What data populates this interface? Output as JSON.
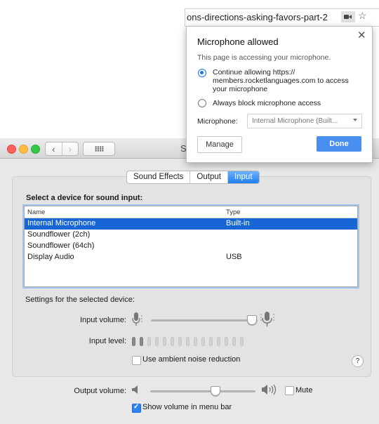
{
  "browser": {
    "url_text": "ons-directions-asking-favors-part-2",
    "camera_icon": "video-camera-icon",
    "bookmark_icon": "star-icon"
  },
  "popup": {
    "title": "Microphone allowed",
    "close_glyph": "✕",
    "subtitle": "This page is accessing your microphone.",
    "options": [
      {
        "line1": "Continue allowing https://",
        "line2": "members.rocketlanguages.com to access",
        "line3": "your microphone",
        "selected": true
      },
      {
        "line1": "Always block microphone access",
        "selected": false
      }
    ],
    "microphone_label": "Microphone:",
    "microphone_value": "Internal Microphone (Built...",
    "manage_label": "Manage",
    "done_label": "Done",
    "accent": "#4a8ef0"
  },
  "window": {
    "title": "S",
    "nav_back": "‹",
    "nav_forward": "›",
    "tabs": [
      {
        "label": "Sound Effects",
        "active": false
      },
      {
        "label": "Output",
        "active": false
      },
      {
        "label": "Input",
        "active": true
      }
    ],
    "select_label": "Select a device for sound input:",
    "table": {
      "headers": [
        "Name",
        "Type"
      ],
      "rows": [
        {
          "name": "Internal Microphone",
          "type": "Built-in",
          "selected": true
        },
        {
          "name": "Soundflower (2ch)",
          "type": ""
        },
        {
          "name": "Soundflower (64ch)",
          "type": ""
        },
        {
          "name": "Display Audio",
          "type": "USB"
        }
      ]
    },
    "settings_label": "Settings for the selected device:",
    "input_volume_label": "Input volume:",
    "input_volume_level": 0.94,
    "input_level_label": "Input level:",
    "input_level_segments": 15,
    "input_level_lit": 2,
    "ambient_label": "Use ambient noise reduction",
    "ambient_checked": false,
    "help_glyph": "?",
    "output_volume_label": "Output volume:",
    "output_volume_level": 0.61,
    "mute_label": "Mute",
    "mute_checked": false,
    "menubar_label": "Show volume in menu bar",
    "menubar_checked": true,
    "selection_color": "#1866d6"
  }
}
